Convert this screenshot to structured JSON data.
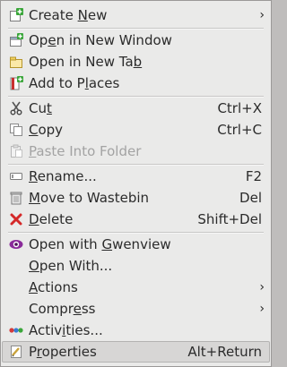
{
  "menu": {
    "items": [
      {
        "label": "Create New",
        "underline": 7,
        "submenu": true,
        "icon": "create-new-icon"
      },
      {
        "label": "Open in New Window",
        "underline": 2,
        "icon": "new-window-icon"
      },
      {
        "label": "Open in New Tab",
        "underline": 14,
        "icon": "new-tab-icon"
      },
      {
        "label": "Add to Places",
        "underline": 8,
        "icon": "add-to-places-icon"
      },
      {
        "label": "Cut",
        "underline": 2,
        "shortcut": "Ctrl+X",
        "icon": "scissors-icon"
      },
      {
        "label": "Copy",
        "underline": 0,
        "shortcut": "Ctrl+C",
        "icon": "copy-icon"
      },
      {
        "label": "Paste Into Folder",
        "underline": 0,
        "disabled": true,
        "icon": "paste-icon"
      },
      {
        "label": "Rename...",
        "underline": 0,
        "shortcut": "F2",
        "icon": "rename-icon"
      },
      {
        "label": "Move to Wastebin",
        "underline": 0,
        "shortcut": "Del",
        "icon": "wastebin-icon"
      },
      {
        "label": "Delete",
        "underline": 0,
        "shortcut": "Shift+Del",
        "icon": "delete-icon"
      },
      {
        "label": "Open with Gwenview",
        "underline": 10,
        "icon": "gwenview-icon"
      },
      {
        "label": "Open With...",
        "underline": 0,
        "icon": "none"
      },
      {
        "label": "Actions",
        "underline": 0,
        "submenu": true,
        "icon": "none"
      },
      {
        "label": "Compress",
        "underline": 5,
        "submenu": true,
        "icon": "none"
      },
      {
        "label": "Activities...",
        "underline": 5,
        "icon": "activities-icon"
      },
      {
        "label": "Properties",
        "underline": 1,
        "shortcut": "Alt+Return",
        "icon": "properties-icon",
        "highlighted": true
      }
    ],
    "submenu_glyph": "›"
  },
  "colors": {
    "menu_bg": "#eaeae9",
    "text": "#2b2b2b",
    "disabled_text": "#a3a3a3",
    "highlight_bg": "#d7d6d5",
    "delete_red": "#d42828",
    "add_green": "#3aa63a",
    "gwenview_purple": "#8a2b9a"
  }
}
